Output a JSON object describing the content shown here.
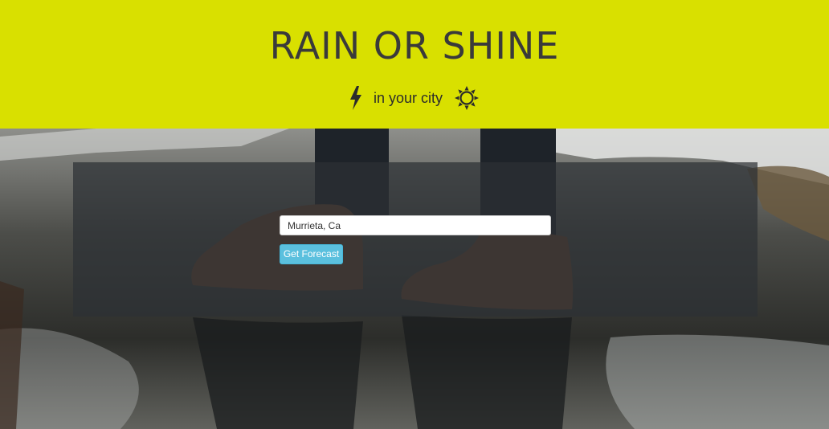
{
  "header": {
    "title": "RAIN OR SHINE",
    "subtitle": "in your city",
    "background_color": "#d9e000",
    "icons": [
      "lightning-bolt-icon",
      "sun-icon"
    ]
  },
  "form": {
    "city_input_value": "Murrieta, Ca",
    "submit_label": "Get Forecast",
    "button_color": "#5bc0de"
  }
}
